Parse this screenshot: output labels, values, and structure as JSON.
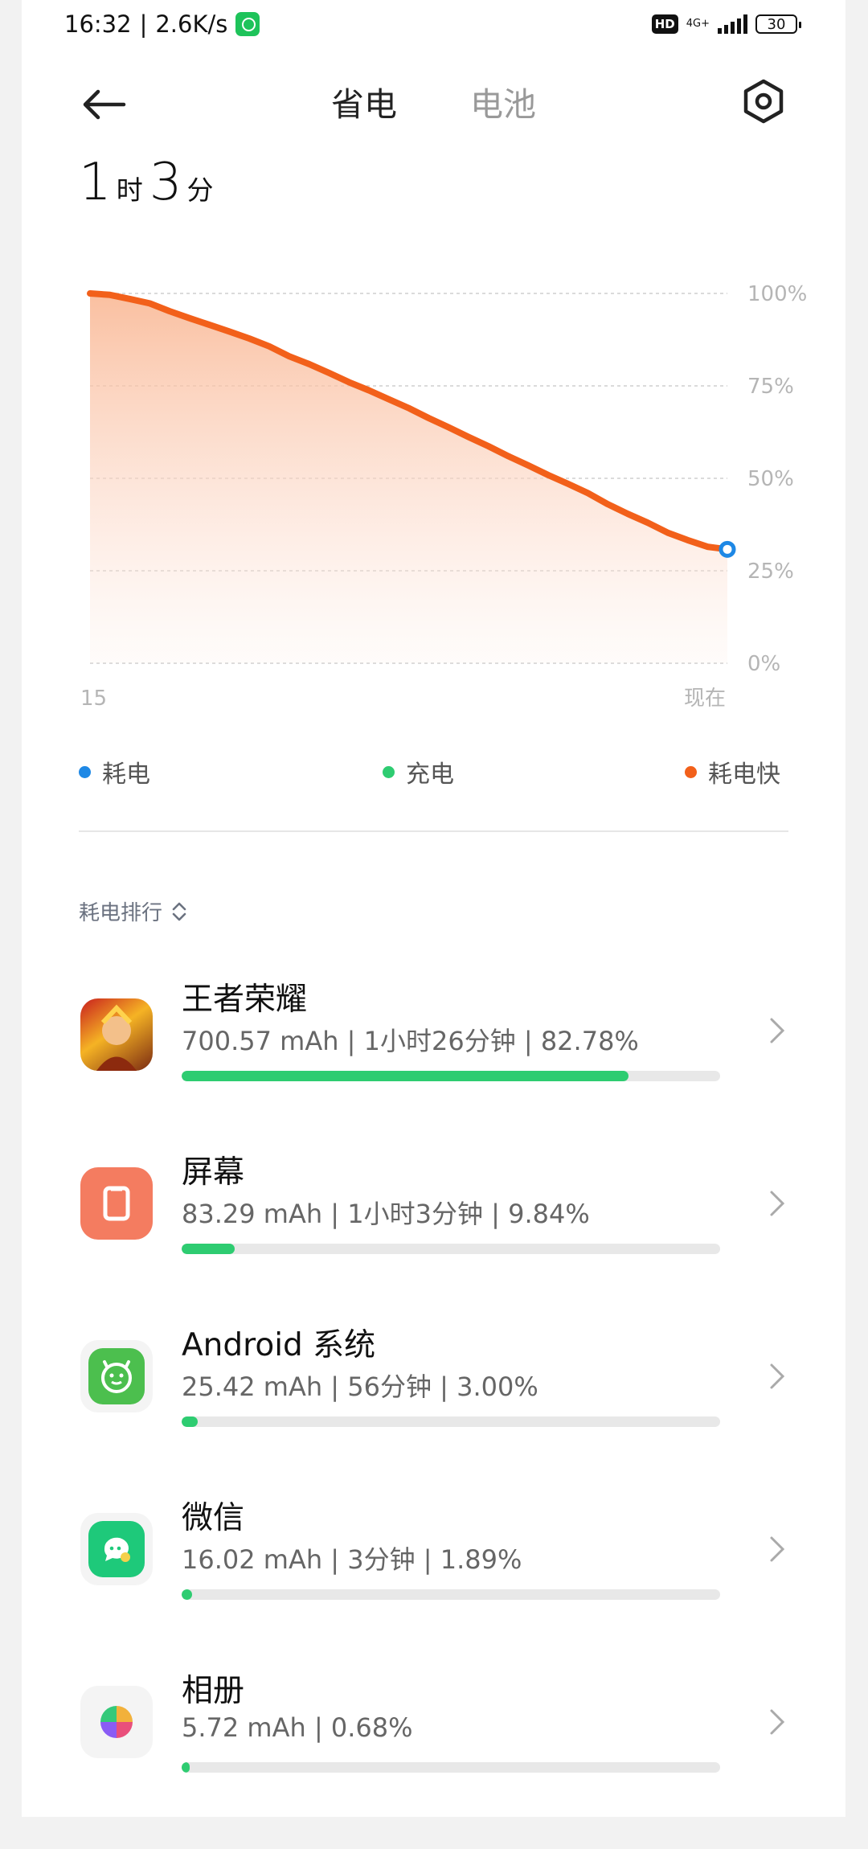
{
  "status_bar": {
    "time": "16:32",
    "net_speed": "2.6K/s",
    "hd": "HD",
    "network": "4G+",
    "battery_level": "30"
  },
  "header": {
    "tab_active": "省电",
    "tab_inactive": "电池"
  },
  "remaining": {
    "hours": "1",
    "hours_unit": "时",
    "minutes": "3",
    "minutes_unit": "分"
  },
  "chart_data": {
    "type": "area",
    "ylabels": [
      "100%",
      "75%",
      "50%",
      "25%",
      "0%"
    ],
    "xlabels": [
      "15",
      "现在"
    ],
    "ylim": [
      0,
      100
    ],
    "x": [
      0,
      1,
      2,
      3,
      4,
      5,
      6,
      7,
      8,
      9,
      10,
      11,
      12,
      13,
      14,
      15,
      16,
      17,
      18,
      19,
      20,
      21,
      22,
      23,
      24,
      25,
      26,
      27,
      28,
      29,
      30,
      31,
      32
    ],
    "values": [
      100,
      99.6,
      98.5,
      97.3,
      95.2,
      93.3,
      91.5,
      89.7,
      87.8,
      85.7,
      83.0,
      80.9,
      78.5,
      76.0,
      73.8,
      71.4,
      69.0,
      66.3,
      63.8,
      61.2,
      58.7,
      56.0,
      53.5,
      50.9,
      48.5,
      46.0,
      43.0,
      40.4,
      38.0,
      35.3,
      33.3,
      31.5,
      30.8
    ],
    "color_line": "#f2601a",
    "marker_color": "#1e88e5",
    "grid": true
  },
  "legend": [
    {
      "label": "耗电",
      "color": "#1e88e5"
    },
    {
      "label": "充电",
      "color": "#2ecc71"
    },
    {
      "label": "耗电快",
      "color": "#f2601a"
    }
  ],
  "sort_label": "耗电排行",
  "apps": [
    {
      "name": "王者荣耀",
      "stat": "700.57 mAh | 1小时26分钟 | 82.78%",
      "percent": 82.78,
      "icon": "game-icon"
    },
    {
      "name": "屏幕",
      "stat": "83.29 mAh | 1小时3分钟 | 9.84%",
      "percent": 9.84,
      "icon": "screen-icon"
    },
    {
      "name": "Android 系统",
      "stat": "25.42 mAh | 56分钟 | 3.00%",
      "percent": 3.0,
      "icon": "android-icon"
    },
    {
      "name": "微信",
      "stat": "16.02 mAh | 3分钟 | 1.89%",
      "percent": 1.89,
      "icon": "wechat-icon"
    },
    {
      "name": "相册",
      "stat": "5.72 mAh | 0.68%",
      "percent": 0.68,
      "icon": "gallery-icon"
    }
  ]
}
